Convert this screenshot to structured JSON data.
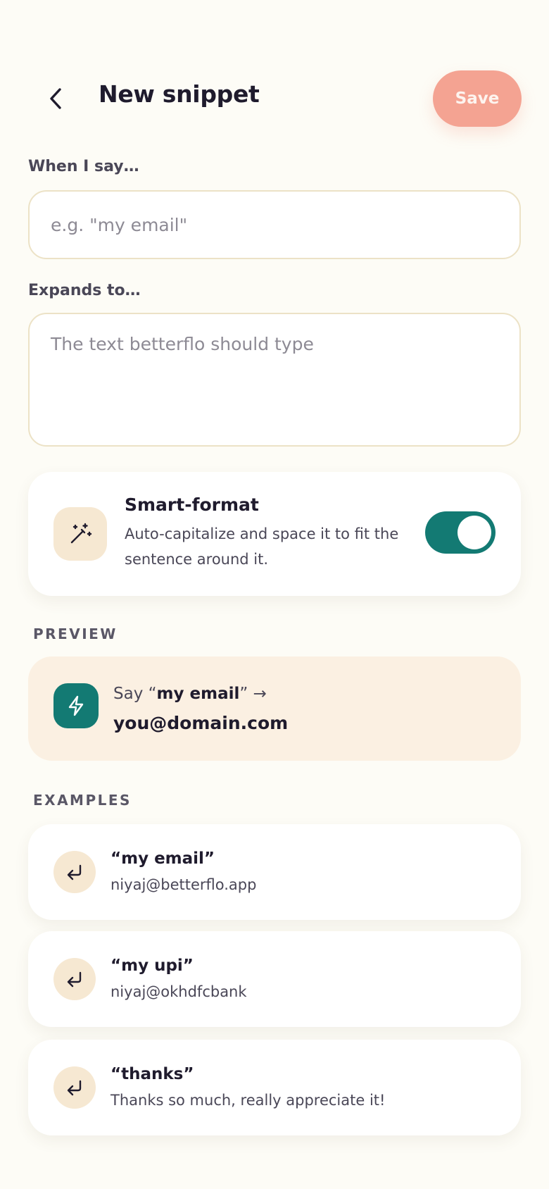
{
  "header": {
    "back_icon": "chevron-left-icon",
    "title": "New snippet",
    "save_label": "Save"
  },
  "trigger": {
    "label": "When I say…",
    "placeholder": "e.g. \"my email\"",
    "value": ""
  },
  "expansion": {
    "label": "Expands to…",
    "placeholder": "The text betterflo should type",
    "value": ""
  },
  "smart_format": {
    "icon": "magic-wand-icon",
    "title": "Smart-format",
    "description": "Auto-capitalize and space it to fit the sentence around it.",
    "enabled": true
  },
  "preview": {
    "section_label": "PREVIEW",
    "icon": "lightning-icon",
    "say_prefix": "Say “",
    "phrase": "my email",
    "say_suffix": "” →",
    "result": "you@domain.com"
  },
  "examples": {
    "section_label": "EXAMPLES",
    "icon": "return-arrow-icon",
    "items": [
      {
        "trigger": "“my email”",
        "expansion": "niyaj@betterflo.app"
      },
      {
        "trigger": "“my upi”",
        "expansion": "niyaj@okhdfcbank"
      },
      {
        "trigger": "“thanks”",
        "expansion": "Thanks so much, really appreciate it!"
      }
    ]
  },
  "colors": {
    "background": "#fdfcf6",
    "accent_teal": "#137a73",
    "save_coral": "#f4a392",
    "tile_beige": "#f6e8d2",
    "preview_bg": "#fbf0e2"
  }
}
